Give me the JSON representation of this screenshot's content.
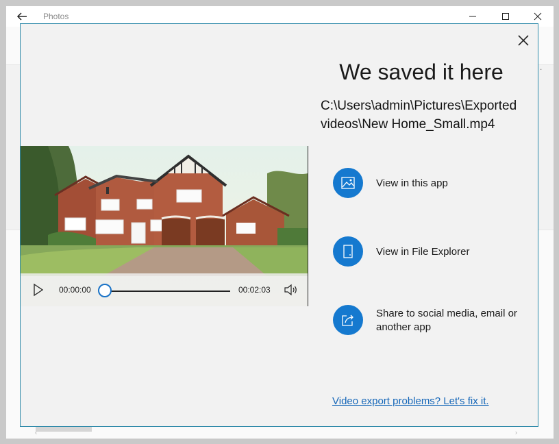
{
  "app": {
    "title": "Photos"
  },
  "dialog": {
    "title": "We saved it here",
    "path": "C:\\Users\\admin\\Pictures\\Exported videos\\New Home_Small.mp4",
    "fix_link": "Video export problems? Let's fix it."
  },
  "player": {
    "current_time": "00:00:00",
    "total_time": "00:02:03",
    "progress": 0
  },
  "actions": [
    {
      "label": "View in this app",
      "icon": "photo-icon"
    },
    {
      "label": "View in File Explorer",
      "icon": "file-icon"
    },
    {
      "label": "Share to social media, email or another app",
      "icon": "share-icon"
    }
  ],
  "colors": {
    "accent": "#1579cf",
    "link": "#1466b8",
    "dialog_border": "#2b88a8",
    "dialog_bg": "#f2f2f2"
  }
}
